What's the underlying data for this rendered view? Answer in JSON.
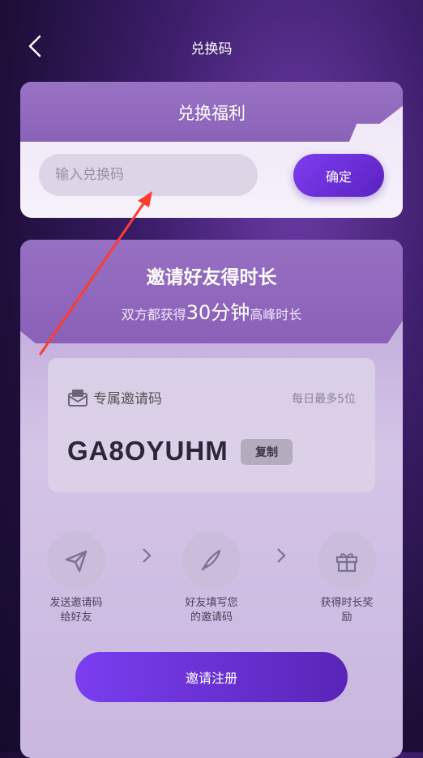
{
  "header": {
    "title": "兑换码"
  },
  "redeem": {
    "title": "兑换福利",
    "placeholder": "输入兑换码",
    "confirm_label": "确定"
  },
  "invite": {
    "title": "邀请好友得时长",
    "subtitle_pre": "双方都获得",
    "subtitle_highlight": "30分钟",
    "subtitle_post": "高峰时长",
    "code_label": "专属邀请码",
    "daily_limit": "每日最多5位",
    "code": "GA8OYUHM",
    "copy_label": "复制",
    "steps": [
      {
        "label_line1": "发送邀请码",
        "label_line2": "给好友",
        "icon": "send-icon"
      },
      {
        "label_line1": "好友填写您",
        "label_line2": "的邀请码",
        "icon": "pen-icon"
      },
      {
        "label_line1": "获得时长奖",
        "label_line2": "励",
        "icon": "gift-icon"
      }
    ],
    "register_label": "邀请注册"
  },
  "colors": {
    "accent": "#6a2fe0",
    "annotation_arrow": "#ff3b30"
  }
}
